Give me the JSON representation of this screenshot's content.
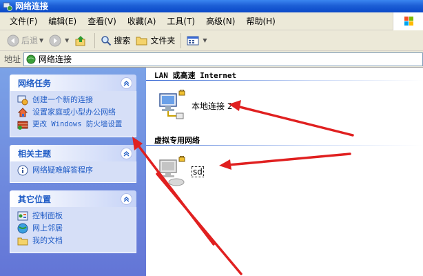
{
  "window": {
    "title": "网络连接"
  },
  "menu": {
    "items": [
      "文件(F)",
      "编辑(E)",
      "查看(V)",
      "收藏(A)",
      "工具(T)",
      "高级(N)",
      "帮助(H)"
    ]
  },
  "toolbar": {
    "back": "后退",
    "search": "搜索",
    "folders": "文件夹"
  },
  "address": {
    "label": "地址",
    "value": "网络连接"
  },
  "panels": {
    "network_tasks": {
      "title": "网络任务",
      "items": [
        "创建一个新的连接",
        "设置家庭或小型办公网络",
        "更改 Windows 防火墙设置"
      ]
    },
    "related": {
      "title": "相关主题",
      "items": [
        "网络疑难解答程序"
      ]
    },
    "other": {
      "title": "其它位置",
      "items": [
        "控制面板",
        "网上邻居",
        "我的文档"
      ]
    }
  },
  "groups": {
    "lan": {
      "header": "LAN 或高速 Internet",
      "connection": "本地连接 2"
    },
    "vpn": {
      "header": "虚拟专用网络",
      "connection": "sd"
    }
  },
  "colors": {
    "arrow": "#e02020",
    "link": "#215dc6",
    "titlebar": "#0a49c8"
  }
}
